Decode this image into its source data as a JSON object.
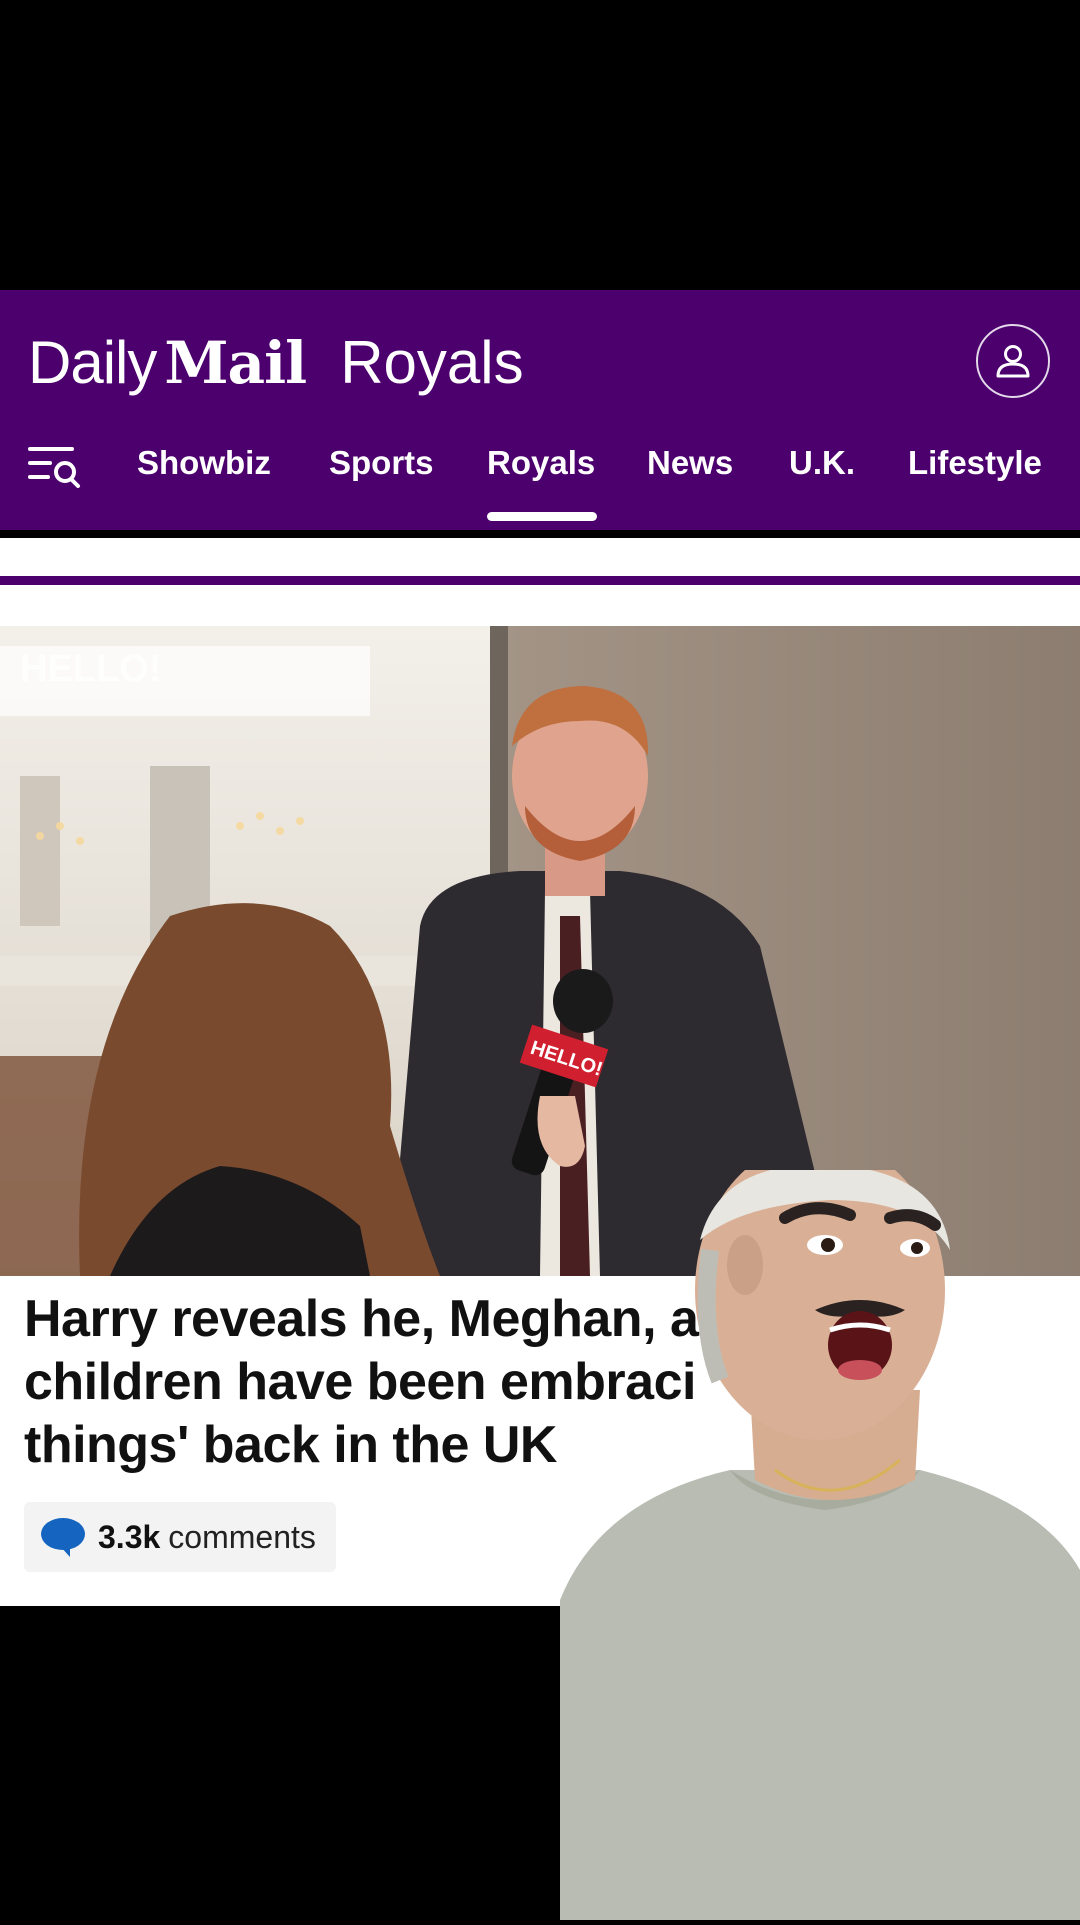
{
  "header": {
    "brand_daily": "Daily",
    "brand_mail": "Mail",
    "section_title": "Royals",
    "account_icon": "user-icon",
    "menu_icon": "menu-search-icon"
  },
  "nav": {
    "items": [
      "Showbiz",
      "Sports",
      "Royals",
      "News",
      "U.K.",
      "Lifestyle"
    ],
    "active": "Royals"
  },
  "article": {
    "watermark": "HELLO!",
    "mic_flag": "HELLO!",
    "headline_line1": "Harry reveals he, Meghan, ar",
    "headline_line2": "children have been embraci",
    "headline_line3": "things' back in the UK",
    "comments_count": "3.3k",
    "comments_label": "comments",
    "comment_icon": "speech-bubble-icon"
  },
  "colors": {
    "brand_purple": "#4b006e",
    "comment_blue": "#1565c0"
  }
}
